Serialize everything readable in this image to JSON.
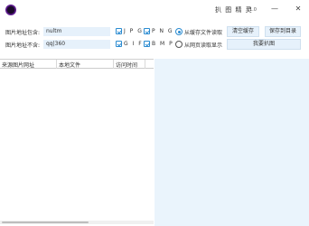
{
  "window": {
    "title": "扒 图 精 灵",
    "version": "v1.0",
    "minimize_glyph": "—",
    "close_glyph": "✕"
  },
  "filters": {
    "include_label": "图片地址包含:",
    "include_value": "nultm",
    "exclude_label": "图片地址不含:",
    "exclude_value": "qq|360"
  },
  "formats": [
    {
      "label": "J P G",
      "checked": true
    },
    {
      "label": "P N G",
      "checked": true
    },
    {
      "label": "G I F",
      "checked": true
    },
    {
      "label": "B M P",
      "checked": true
    }
  ],
  "source_options": [
    {
      "label": "从缓存文件读取",
      "selected": true
    },
    {
      "label": "从网页读取显示",
      "selected": false
    }
  ],
  "buttons": {
    "clear_cache": "清空缓存",
    "save_to_dir": "保存到目录",
    "grab_images": "我要扒图"
  },
  "table": {
    "columns": [
      "来源图片网址",
      "本地文件",
      "访问时间"
    ],
    "rows": []
  },
  "colors": {
    "accent": "#2a8bd1",
    "input_bg": "#e6f1fb",
    "panel_bg": "#eaf4fc"
  }
}
